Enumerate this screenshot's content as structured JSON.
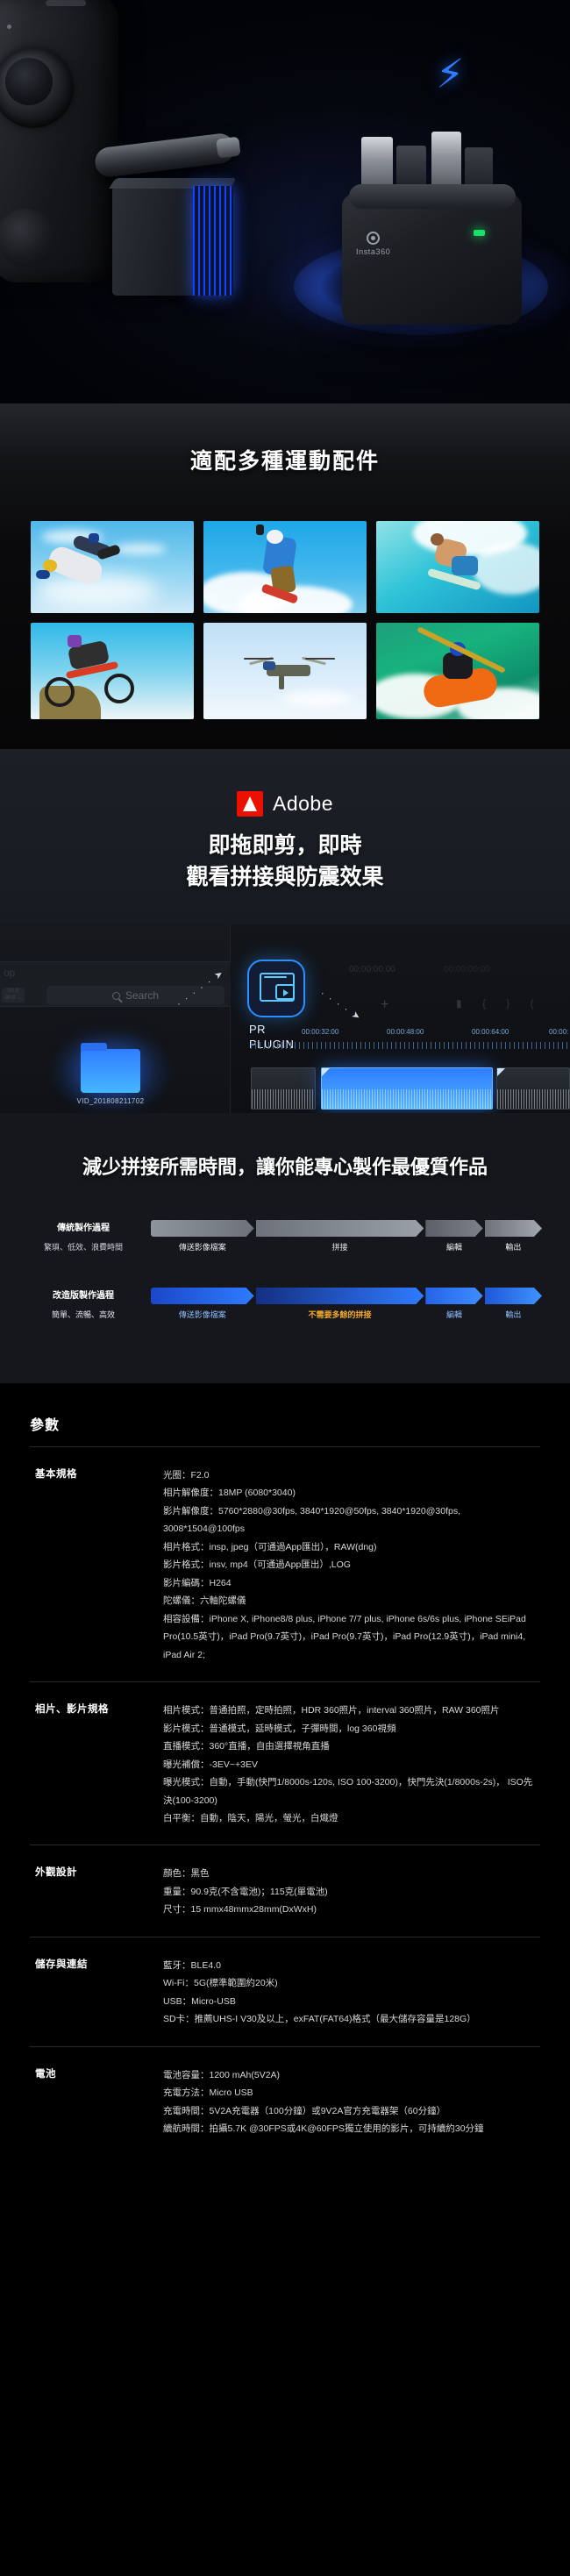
{
  "hero": {
    "brand_label": "Insta360",
    "bolt_icon": "lightning-bolt-icon"
  },
  "accessories": {
    "title": "適配多種運動配件",
    "photos": [
      {
        "name": "skydiving-photo",
        "alt": "skydiver"
      },
      {
        "name": "snowboarding-photo",
        "alt": "snowboarder"
      },
      {
        "name": "surfing-photo",
        "alt": "surfer"
      },
      {
        "name": "mountain-biking-photo",
        "alt": "mountain biker"
      },
      {
        "name": "drone-photo",
        "alt": "drone"
      },
      {
        "name": "kayaking-photo",
        "alt": "kayaker"
      }
    ]
  },
  "adobe": {
    "brand": "Adobe",
    "headline_line1": "即拖即剪，即時",
    "headline_line2": "觀看拼接與防震效果",
    "editor": {
      "search_placeholder": "Search",
      "top_label": "op",
      "folder_name": "VID_201808211702",
      "plugin_line1": "PR",
      "plugin_line2": "PLUGIN",
      "timecodes": [
        "00:00:00:00",
        "00:00:00:00"
      ],
      "ruler_marks": [
        "00:00:32:00",
        "00:00:48:00",
        "00:00:64:00",
        "00:00:"
      ],
      "plus_icon": "plus-icon"
    }
  },
  "comparison": {
    "headline": "減少拼接所需時間，讓你能專心製作最優質作品",
    "rows": [
      {
        "title": "傳統製作過程",
        "subtitle": "繁瑣、低效、浪費時間",
        "style": "gray",
        "segments": [
          {
            "label": "傳送影像檔案",
            "width": 27
          },
          {
            "label": "拼接",
            "width": 44
          },
          {
            "label": "編輯",
            "width": 16
          },
          {
            "label": "輸出",
            "width": 16
          }
        ]
      },
      {
        "title": "改造版製作過程",
        "subtitle": "簡單、流暢、高效",
        "style": "blue",
        "segments": [
          {
            "label": "傳送影像檔案",
            "width": 27,
            "highlight": false
          },
          {
            "label": "不需要多餘的拼接",
            "width": 44,
            "highlight": true
          },
          {
            "label": "編輯",
            "width": 16,
            "highlight": false
          },
          {
            "label": "輸出",
            "width": 16,
            "highlight": false
          }
        ]
      }
    ]
  },
  "specs": {
    "title": "參數",
    "rows": [
      {
        "key": "基本規格",
        "values": [
          "光圈：F2.0",
          "相片解像度：18MP (6080*3040)",
          "影片解像度：5760*2880@30fps, 3840*1920@50fps, 3840*1920@30fps, 3008*1504@100fps",
          "相片格式：insp, jpeg（可通過App匯出），RAW(dng)",
          "影片格式：insv, mp4（可通過App匯出）,LOG",
          "影片編碼：H264",
          "陀螺儀：六軸陀螺儀",
          "相容設備：iPhone X, iPhone8/8 plus, iPhone 7/7 plus, iPhone 6s/6s plus, iPhone SEiPad Pro(10.5英寸)，iPad Pro(9.7英寸)，iPad Pro(9.7英寸)，iPad Pro(12.9英寸)，iPad mini4, iPad Air 2;"
        ]
      },
      {
        "key": "相片、影片規格",
        "values": [
          "相片模式：普通拍照，定時拍照，HDR 360照片，interval 360照片，RAW 360照片",
          "影片模式：普通模式，延時模式，子彈時間，log 360視頻",
          "直播模式：360°直播，自由選擇視角直播",
          "曝光補償：-3EV~+3EV",
          "曝光模式：自動，手動(快門1/8000s-120s, ISO 100-3200)，快門先決(1/8000s-2s)， ISO先決(100-3200)",
          "白平衡：自動，陰天，陽光，螢光，白熾燈"
        ]
      },
      {
        "key": "外觀設計",
        "values": [
          "顏色：黑色",
          "重量：90.9克(不含電池)；115克(單電池)",
          "尺寸：15 mmx48mmx28mm(DxWxH)"
        ]
      },
      {
        "key": "儲存與連結",
        "values": [
          "藍牙：BLE4.0",
          "Wi-Fi：5G(標準範圍約20米)",
          "USB：Micro-USB",
          "SD卡：推薦UHS-I V30及以上，exFAT(FAT64)格式（最大儲存容量是128G）"
        ]
      },
      {
        "key": "電池",
        "values": [
          "電池容量：1200 mAh(5V2A)",
          "充電方法：Micro USB",
          "充電時間：5V2A充電器（100分鐘）或9V2A官方充電器架（60分鐘）",
          "續航時間：拍攝5.7K @30FPS或4K@60FPS獨立使用的影片，可持續約30分鐘"
        ]
      }
    ]
  },
  "colors": {
    "accent_blue": "#2f7bff",
    "adobe_red": "#eb1000",
    "highlight_orange": "#f0a92e",
    "led_green": "#19e06a"
  }
}
